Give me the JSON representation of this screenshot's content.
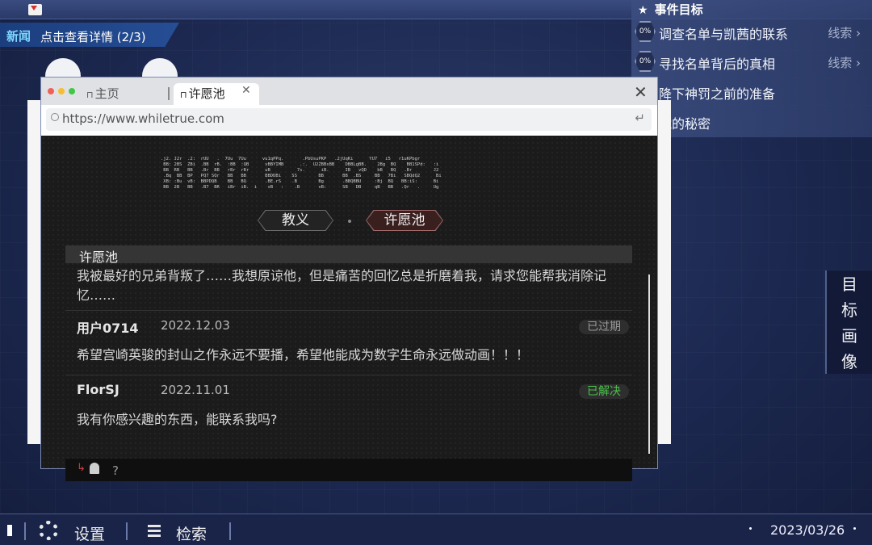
{
  "news": {
    "tag": "新闻",
    "text": "点击查看详情 (2/3)"
  },
  "objectives": {
    "header": "事件目标",
    "items": [
      {
        "progress": "0%",
        "text": "调查名单与凯茜的联系",
        "clue": "线索"
      },
      {
        "progress": "0%",
        "text": "寻找名单背后的真相",
        "clue": "线索"
      },
      {
        "progress": "",
        "text": "降下神罚之前的准备",
        "clue": ""
      },
      {
        "progress": "",
        "text": "藏的秘密",
        "clue": ""
      }
    ]
  },
  "side_panel": {
    "chars": [
      "目",
      "标",
      "画",
      "像"
    ]
  },
  "browser": {
    "tabs": [
      {
        "label": "主页"
      },
      {
        "label": "许愿池"
      }
    ],
    "url": "https://www.whiletrue.com",
    "nav": [
      {
        "label": "教义"
      },
      {
        "label": "许愿池"
      }
    ],
    "wish": {
      "title": "许愿池",
      "text": "我被最好的兄弟背叛了……我想原谅他，但是痛苦的回忆总是折磨着我，请求您能帮我消除记忆……"
    },
    "entries": [
      {
        "user": "用户0714",
        "date": "2022.12.03",
        "status": "已过期",
        "text": "希望宫崎英骏的封山之作永远不要播，希望他能成为数字生命永远做动画！！！"
      },
      {
        "user": "FlorSJ",
        "date": "2022.11.01",
        "status": "已解决",
        "text": "我有你感兴趣的东西，能联系我吗?"
      }
    ],
    "reply_placeholder": "?"
  },
  "bottombar": {
    "settings": "设置",
    "search": "检索",
    "date": "2023/03/26"
  },
  "colors": {
    "accent": "#7fd8ff",
    "solved": "#4cc04a",
    "expired": "#9a9a9a",
    "bg": "#1c2850"
  }
}
